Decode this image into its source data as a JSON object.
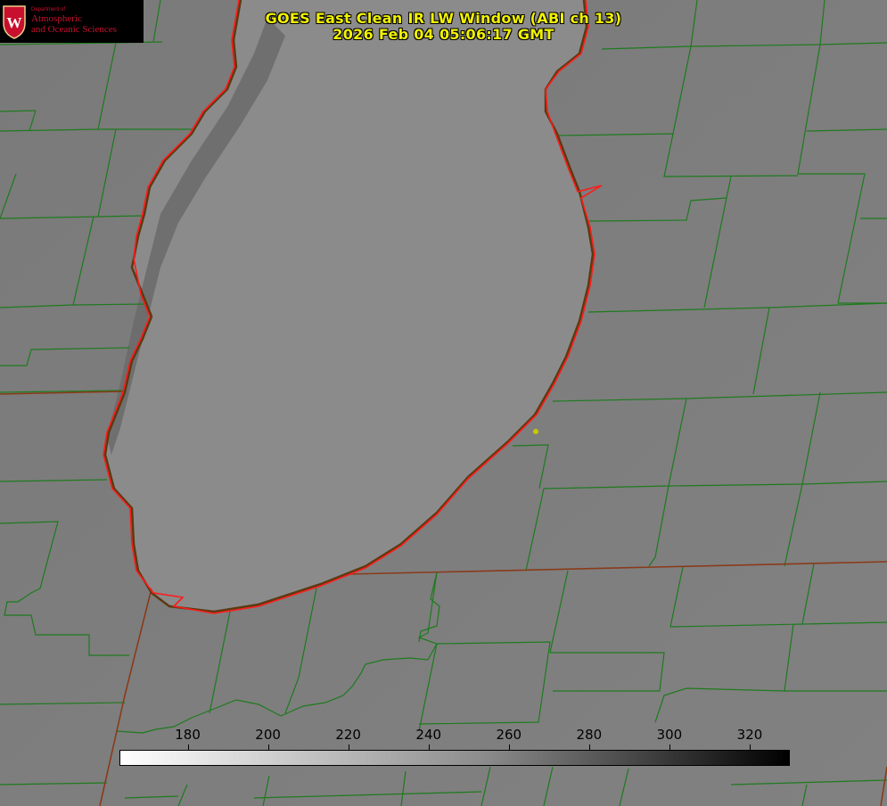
{
  "title": {
    "line1": "GOES East Clean IR LW Window (ABI ch 13)",
    "line2": "2026 Feb 04 05:06:17 GMT"
  },
  "logo": {
    "department": "Department of",
    "name_line1": "Atmospheric",
    "name_line2": "and Oceanic Sciences",
    "crest_letter": "W"
  },
  "colorbar": {
    "ticks": [
      "180",
      "200",
      "220",
      "240",
      "260",
      "280",
      "300",
      "320"
    ],
    "min": 163,
    "max": 330,
    "gradient": [
      "#ffffff",
      "#000000"
    ]
  },
  "colors": {
    "title": "#f2f200",
    "county_lines": "#1e7a1e",
    "coastline": "#ff1a1a",
    "state_lines": "#8a3a1a",
    "background": "#7d7d7d",
    "marker": "#c8c800"
  }
}
